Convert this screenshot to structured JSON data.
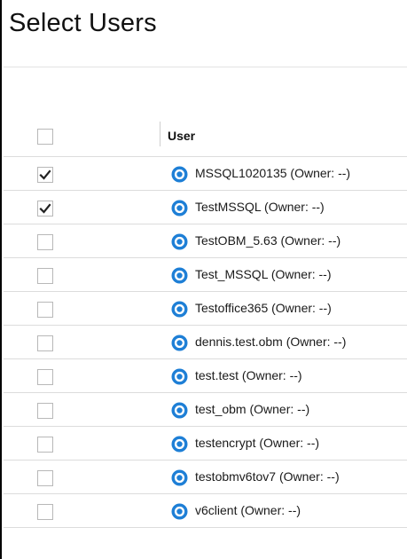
{
  "page": {
    "title": "Select Users"
  },
  "table": {
    "column_user": "User",
    "rows": [
      {
        "label": "MSSQL1020135 (Owner: --)",
        "checked": true
      },
      {
        "label": "TestMSSQL (Owner: --)",
        "checked": true
      },
      {
        "label": "TestOBM_5.63 (Owner: --)",
        "checked": false
      },
      {
        "label": "Test_MSSQL (Owner: --)",
        "checked": false
      },
      {
        "label": "Testoffice365 (Owner: --)",
        "checked": false
      },
      {
        "label": "dennis.test.obm (Owner: --)",
        "checked": false
      },
      {
        "label": "test.test (Owner: --)",
        "checked": false
      },
      {
        "label": "test_obm (Owner: --)",
        "checked": false
      },
      {
        "label": "testencrypt (Owner: --)",
        "checked": false
      },
      {
        "label": "testobmv6tov7 (Owner: --)",
        "checked": false
      },
      {
        "label": "v6client (Owner: --)",
        "checked": false
      }
    ]
  },
  "icons": {
    "user": "user-circle-icon",
    "check": "checkmark-icon"
  },
  "colors": {
    "icon_blue": "#1e7fd6",
    "checkbox_border": "#b8b8b8",
    "row_divider": "#dcdcdc"
  }
}
